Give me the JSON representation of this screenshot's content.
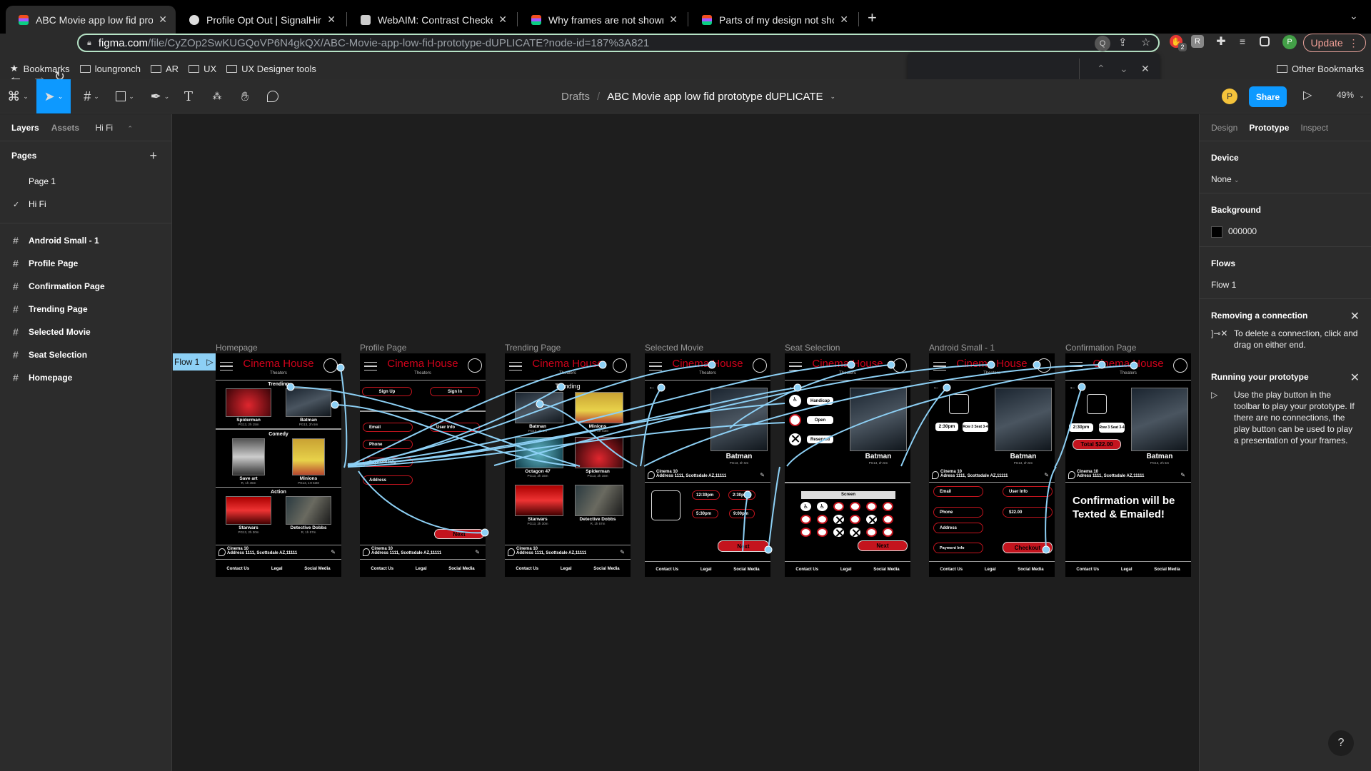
{
  "browser": {
    "tabs": [
      {
        "title": "ABC Movie app low fid prototyp",
        "icon": "figma-icon",
        "active": true
      },
      {
        "title": "Profile Opt Out | SignalHire",
        "icon": "signalhire-icon",
        "active": false
      },
      {
        "title": "WebAIM: Contrast Checker",
        "icon": "webaim-icon",
        "active": false
      },
      {
        "title": "Why frames are not shown in p",
        "icon": "figma-icon",
        "active": false
      },
      {
        "title": "Parts of my design not showing",
        "icon": "figma-icon",
        "active": false
      }
    ],
    "url_host": "figma.com",
    "url_path": "/file/CyZOp2SwKUGQoVP6N4gkQX/ABC-Movie-app-low-fid-prototype-dUPLICATE?node-id=187%3A821",
    "extension_badge": "2",
    "profile_initial": "P",
    "update_label": "Update",
    "bookmarks": [
      {
        "label": "Bookmarks",
        "icon": "star-icon"
      },
      {
        "label": "loungronch",
        "icon": "folder-icon"
      },
      {
        "label": "AR",
        "icon": "folder-icon"
      },
      {
        "label": "UX",
        "icon": "folder-icon"
      },
      {
        "label": "UX Designer tools",
        "icon": "folder-icon"
      }
    ],
    "other_bookmarks": "Other Bookmarks"
  },
  "figma": {
    "breadcrumb_parent": "Drafts",
    "file_name": "ABC Movie app low fid prototype dUPLICATE",
    "avatar_initial": "P",
    "share_label": "Share",
    "zoom": "49%",
    "left_panel": {
      "tab_layers": "Layers",
      "tab_assets": "Assets",
      "current_page": "Hi Fi",
      "pages_heading": "Pages",
      "pages": [
        {
          "label": "Page 1",
          "selected": false
        },
        {
          "label": "Hi Fi",
          "selected": true
        }
      ],
      "layers": [
        "Android Small - 1",
        "Profile Page",
        "Confirmation Page",
        "Trending Page",
        "Selected Movie",
        "Seat Selection",
        "Homepage"
      ]
    },
    "right_panel": {
      "tabs": [
        "Design",
        "Prototype",
        "Inspect"
      ],
      "active_tab": "Prototype",
      "device_heading": "Device",
      "device_value": "None",
      "background_heading": "Background",
      "background_value": "000000",
      "background_color": "#000000",
      "flows_heading": "Flows",
      "flow_item": "Flow 1",
      "tip1_title": "Removing a connection",
      "tip1_body": "To delete a connection, click and drag on either end.",
      "tip2_title": "Running your prototype",
      "tip2_body": "Use the play button in the toolbar to play your prototype. If there are no connections, the play button can be used to play a presentation of your frames."
    },
    "help_label": "?"
  },
  "canvas": {
    "flow_tag": "Flow 1",
    "brand": "Cinema House",
    "brand_sub": "Theaters",
    "brand_color": "#d0021b",
    "connector_color": "#8dd0f5",
    "location_name": "Cinema 10",
    "location_address": "Address 1111, Scottsdale AZ,11111",
    "location_address_alt": "Adress 1111, Scottsdale AZ,11111",
    "footer": [
      "Contact Us",
      "Legal",
      "Social Media"
    ],
    "frames": {
      "homepage": {
        "label": "Homepage",
        "sections": [
          {
            "title": "Trending",
            "movies": [
              {
                "name": "Spiderman",
                "meta": "PG13, 2h 15m"
              },
              {
                "name": "Batman",
                "meta": "PG13, 2h 5m"
              }
            ]
          },
          {
            "title": "Comedy",
            "movies": [
              {
                "name": "Save art",
                "meta": "R, 1h 45m"
              },
              {
                "name": "Minions",
                "meta": "PG13, 1H 53M"
              }
            ]
          },
          {
            "title": "Action",
            "movies": [
              {
                "name": "Starwars",
                "meta": "PG13, 2h 30m"
              },
              {
                "name": "Detective Dobbs",
                "meta": "R, 1h 57m"
              }
            ]
          }
        ]
      },
      "profile": {
        "label": "Profile Page",
        "sign_up": "Sign Up",
        "sign_in": "Sign In",
        "fields": [
          "Email",
          "Phone",
          "Payment Info",
          "Address"
        ],
        "user_info": "User Info",
        "next": "Next"
      },
      "trending": {
        "label": "Trending Page",
        "title": "Trending",
        "movies": [
          {
            "name": "Batman",
            "meta": "PG13, 2h 5m"
          },
          {
            "name": "Minions",
            "meta": "PG13, 1H 53M"
          },
          {
            "name": "Octagon 47",
            "meta": "PG13, 2h 15m"
          },
          {
            "name": "Spiderman",
            "meta": "PG13, 2h 15m"
          },
          {
            "name": "Starwars",
            "meta": "PG13, 2h 30m"
          },
          {
            "name": "Detective Dobbs",
            "meta": "R, 1h 57m"
          }
        ]
      },
      "selected": {
        "label": "Selected Movie",
        "movie": "Batman",
        "meta": "PG13, 2h 5m",
        "times": [
          "12:30pm",
          "2:30pm",
          "5:30pm",
          "9:00pm"
        ],
        "next": "Next"
      },
      "seats": {
        "label": "Seat Selection",
        "legend": [
          "Handicap",
          "Open",
          "Reserved"
        ],
        "movie": "Batman",
        "meta": "PG13, 2h 5m",
        "screen": "Screen",
        "rows": [
          [
            "handicap",
            "handicap",
            "open",
            "open",
            "open",
            "open"
          ],
          [
            "open",
            "open",
            "reserved",
            "open",
            "reserved",
            "open"
          ],
          [
            "open",
            "open",
            "reserved",
            "reserved",
            "open",
            "open"
          ]
        ],
        "next": "Next"
      },
      "android": {
        "label": "Android Small - 1",
        "time": "2:30pm",
        "seat": "Row 3 Seat 3-4",
        "movie": "Batman",
        "meta": "PG13, 2h 5m",
        "fields_left": [
          "Email",
          "Phone",
          "Address",
          "Payment Info"
        ],
        "user_info": "User Info",
        "price": "$22.00",
        "checkout": "Checkout"
      },
      "confirmation": {
        "label": "Confirmation Page",
        "time": "2:30pm",
        "seat": "Row 3 Seat 3-4",
        "total": "Total $22.00",
        "movie": "Batman",
        "meta": "PG13, 2h 5m",
        "message": "Confirmation will be Texted & Emailed!"
      }
    }
  }
}
